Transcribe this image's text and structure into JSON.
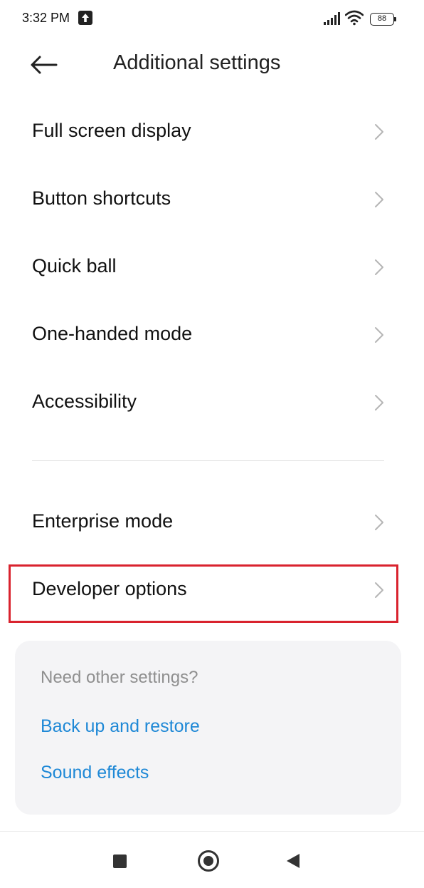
{
  "status_bar": {
    "time": "3:32 PM",
    "battery": "88",
    "icons": [
      "upload-icon",
      "signal-icon",
      "wifi-icon",
      "battery-icon"
    ]
  },
  "header": {
    "title": "Additional settings",
    "back_icon": "arrow-left-icon"
  },
  "settings": {
    "items": [
      {
        "label": "Full screen display"
      },
      {
        "label": "Button shortcuts"
      },
      {
        "label": "Quick ball"
      },
      {
        "label": "One-handed mode"
      },
      {
        "label": "Accessibility"
      },
      {
        "label": "Enterprise mode"
      },
      {
        "label": "Developer options",
        "highlighted": true
      }
    ]
  },
  "suggestions": {
    "title": "Need other settings?",
    "links": [
      {
        "label": "Back up and restore"
      },
      {
        "label": "Sound effects"
      }
    ]
  },
  "nav_bar": {
    "buttons": [
      "recents-button",
      "home-button",
      "back-button"
    ]
  },
  "colors": {
    "highlight": "#d9232e",
    "link": "#1e88d6",
    "card_background": "#f4f4f6",
    "muted_text": "#8f8f8f"
  }
}
